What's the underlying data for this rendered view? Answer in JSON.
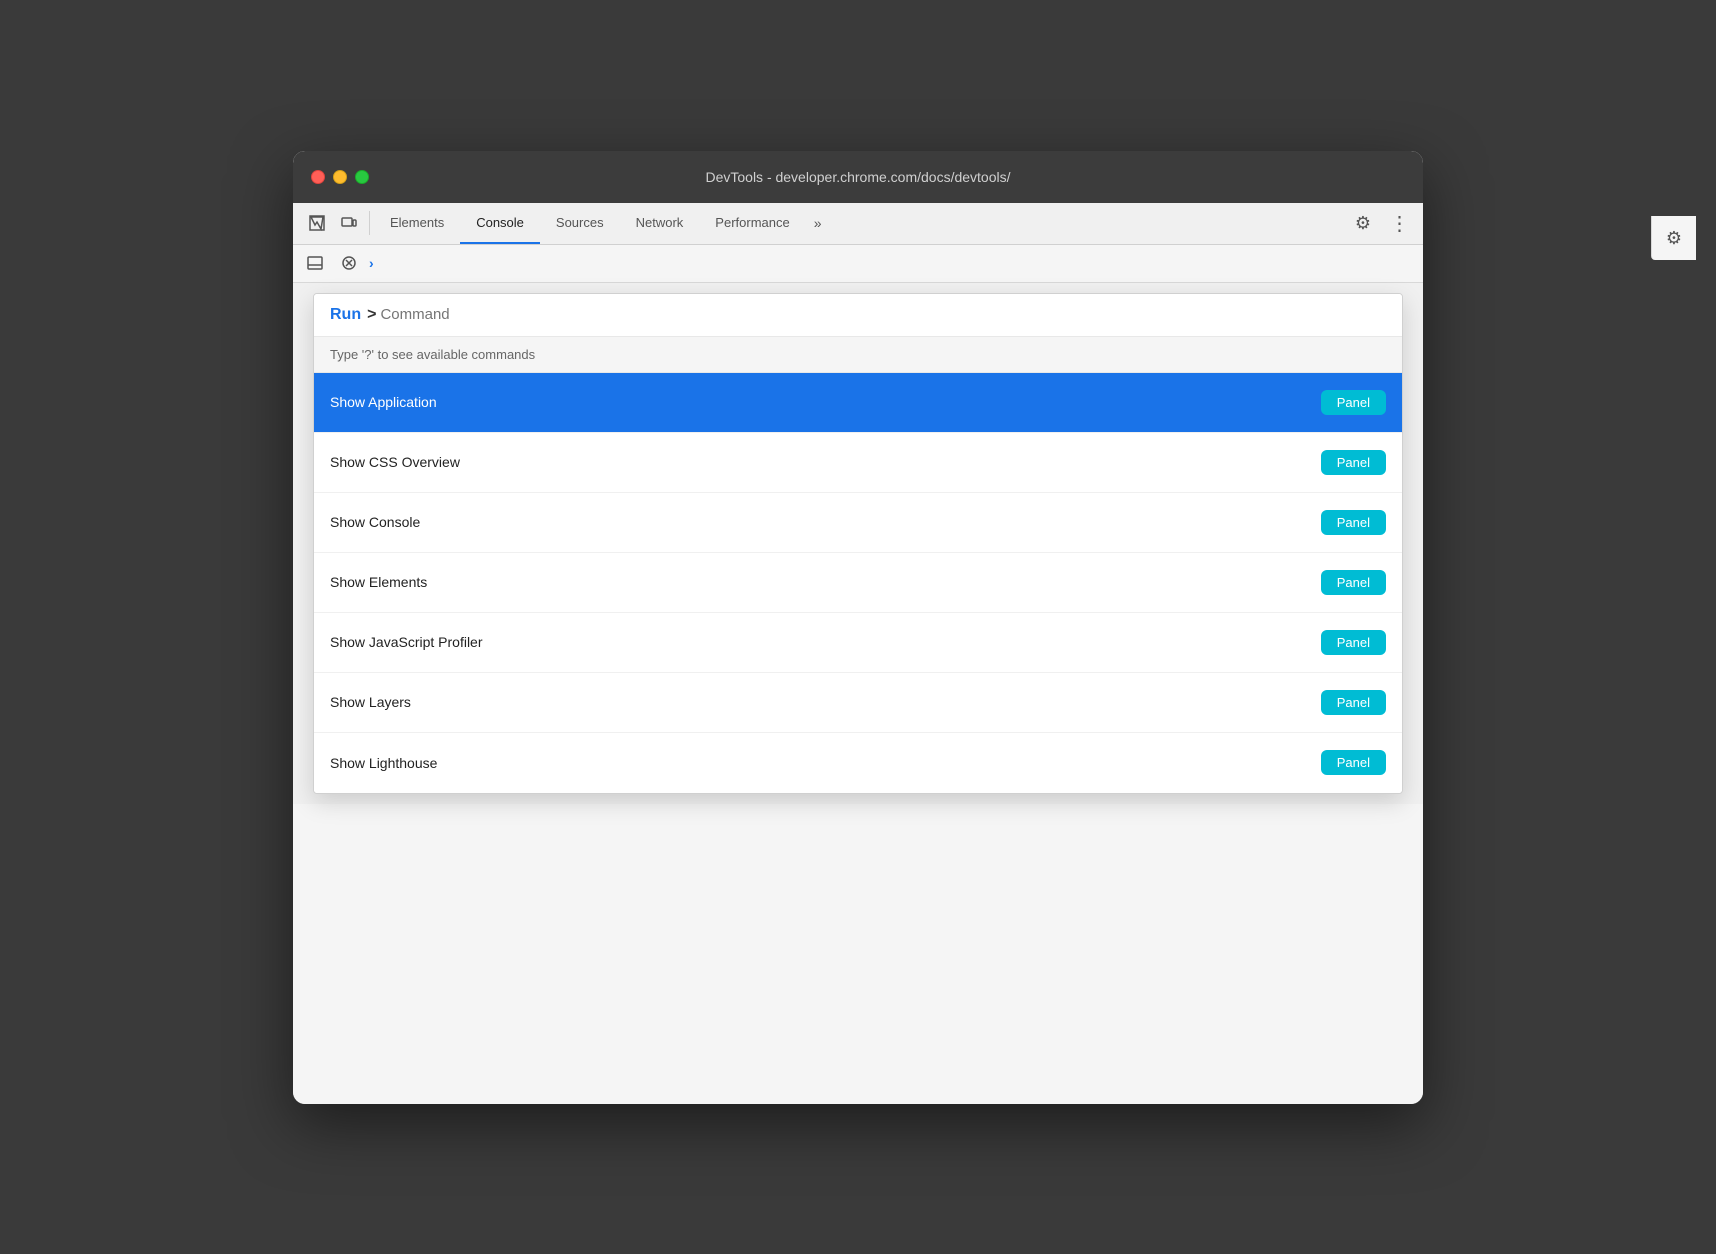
{
  "titleBar": {
    "title": "DevTools - developer.chrome.com/docs/devtools/"
  },
  "toolbar": {
    "tabs": [
      {
        "id": "elements",
        "label": "Elements",
        "active": false
      },
      {
        "id": "console",
        "label": "Console",
        "active": true
      },
      {
        "id": "sources",
        "label": "Sources",
        "active": false
      },
      {
        "id": "network",
        "label": "Network",
        "active": false
      },
      {
        "id": "performance",
        "label": "Performance",
        "active": false
      }
    ],
    "overflow": "»",
    "gearIcon": "⚙",
    "dotsIcon": "⋮"
  },
  "secondaryToolbar": {
    "chevron": "›"
  },
  "commandPalette": {
    "runLabel": "Run",
    "chevron": ">",
    "inputPlaceholder": "Command",
    "hint": "Type '?' to see available commands",
    "items": [
      {
        "id": "show-application",
        "name": "Show Application",
        "badge": "Panel",
        "selected": true
      },
      {
        "id": "show-css-overview",
        "name": "Show CSS Overview",
        "badge": "Panel",
        "selected": false
      },
      {
        "id": "show-console",
        "name": "Show Console",
        "badge": "Panel",
        "selected": false
      },
      {
        "id": "show-elements",
        "name": "Show Elements",
        "badge": "Panel",
        "selected": false
      },
      {
        "id": "show-javascript-profiler",
        "name": "Show JavaScript Profiler",
        "badge": "Panel",
        "selected": false
      },
      {
        "id": "show-layers",
        "name": "Show Layers",
        "badge": "Panel",
        "selected": false
      },
      {
        "id": "show-lighthouse",
        "name": "Show Lighthouse",
        "badge": "Panel",
        "selected": false
      }
    ]
  },
  "colors": {
    "activeTab": "#1a73e8",
    "panelBadge": "#00bcd4",
    "selectedItem": "#1a73e8",
    "runLabel": "#1a73e8"
  }
}
